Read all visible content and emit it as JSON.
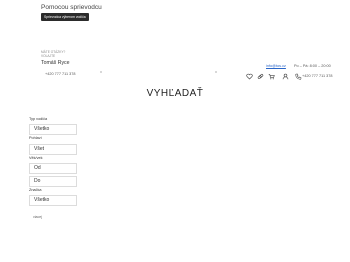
{
  "header": {
    "guide_title": "Pomocou sprievodcu",
    "guide_button": "Sprievodca výberom vodiča",
    "advisor": {
      "caption_line1": "Máte otázky?",
      "caption_line2": "Volajte",
      "name": "Tomáš Ryce",
      "phone": "+420 777 711 378"
    },
    "contact": {
      "email": "info@tos.cz",
      "hours": "Po – Pá: 8:00 – 20:00",
      "phone": "+420 777 711 378"
    },
    "icons": [
      "heart-icon",
      "link-icon",
      "cart-icon",
      "user-icon",
      "phone-icon"
    ]
  },
  "main": {
    "title": "VYHĽADAŤ"
  },
  "filters": {
    "type_label": "Typ vodiča",
    "type_value": "Všetko",
    "gender_label": "Pohlaví",
    "gender_value": "Všet",
    "age_label": "Věk/vek",
    "age_from": "Od",
    "age_to": "Do",
    "brand_label": "Značka",
    "brand_value": "Všetko",
    "more": "viacej"
  }
}
